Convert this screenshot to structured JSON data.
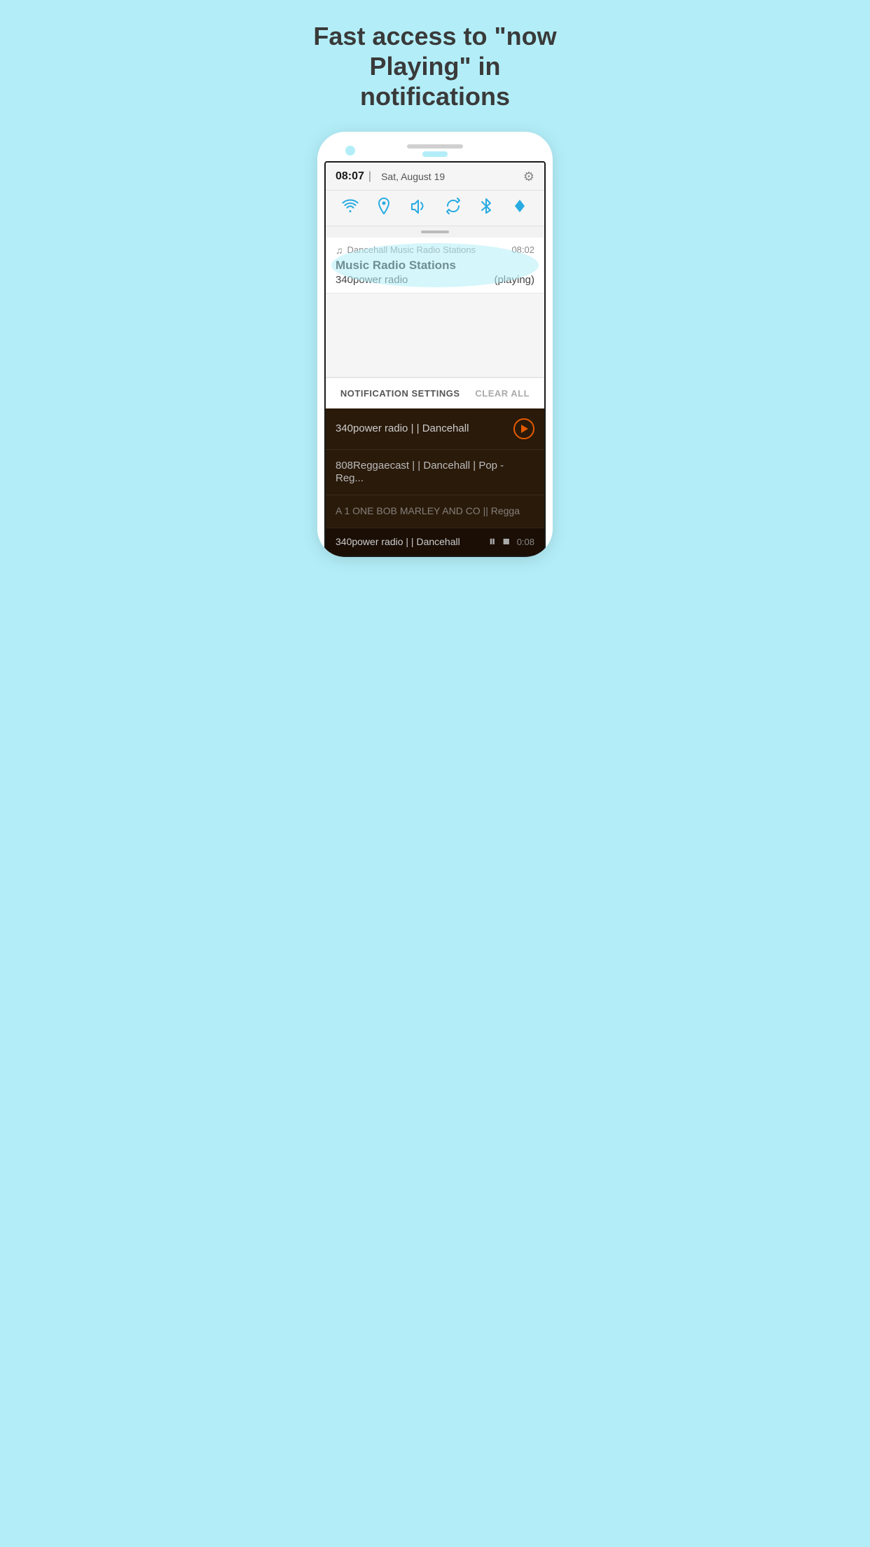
{
  "headline": "Fast access to \"now Playing\" in notifications",
  "phone": {
    "status_bar": {
      "time": "08:07",
      "separator": "|",
      "date": "Sat, August 19"
    },
    "quick_settings": {
      "icons": [
        "wifi",
        "location",
        "volume",
        "sync",
        "bluetooth",
        "data"
      ]
    },
    "notification": {
      "app_icon": "♫",
      "app_name": "Dancehall Music Radio Stations",
      "time": "08:02",
      "title": "Music Radio Stations",
      "station": "340power radio",
      "status": "(playing)"
    },
    "actions": {
      "settings_label": "NOTIFICATION SETTINGS",
      "clear_label": "CLEAR ALL"
    }
  },
  "app": {
    "stations": [
      {
        "name": "340power radio | | Dancehall",
        "has_play": true
      },
      {
        "name": "808Reggaecast | | Dancehall | Pop - Reg...",
        "has_play": false
      },
      {
        "name": "A 1 ONE BOB MARLEY AND CO || Regga",
        "has_play": false,
        "partial": true
      }
    ],
    "player": {
      "station": "340power radio | | Dancehall",
      "time": "0:08"
    }
  }
}
